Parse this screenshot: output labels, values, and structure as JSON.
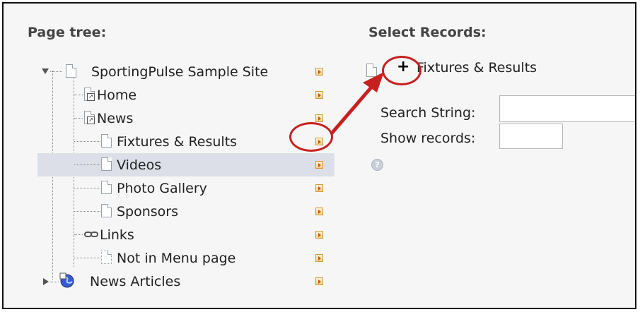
{
  "page_tree": {
    "heading": "Page tree:",
    "root_label": "SportingPulse Sample Site",
    "items": [
      {
        "label": "Home"
      },
      {
        "label": "News"
      },
      {
        "label": "Fixtures & Results"
      },
      {
        "label": "Videos"
      },
      {
        "label": "Photo Gallery"
      },
      {
        "label": "Sponsors"
      },
      {
        "label": "Links"
      },
      {
        "label": "Not in Menu page"
      }
    ],
    "folder_label": "News Articles"
  },
  "select_records": {
    "heading": "Select Records:",
    "record_label": "Fixtures & Results",
    "plus_symbol": "+",
    "search_label": "Search String:",
    "search_value": "",
    "show_label": "Show records:",
    "show_value": ""
  },
  "colors": {
    "selected_row": "#dcdfe8",
    "annotation": "#c82020",
    "arrow_button": "#f4d18f"
  }
}
